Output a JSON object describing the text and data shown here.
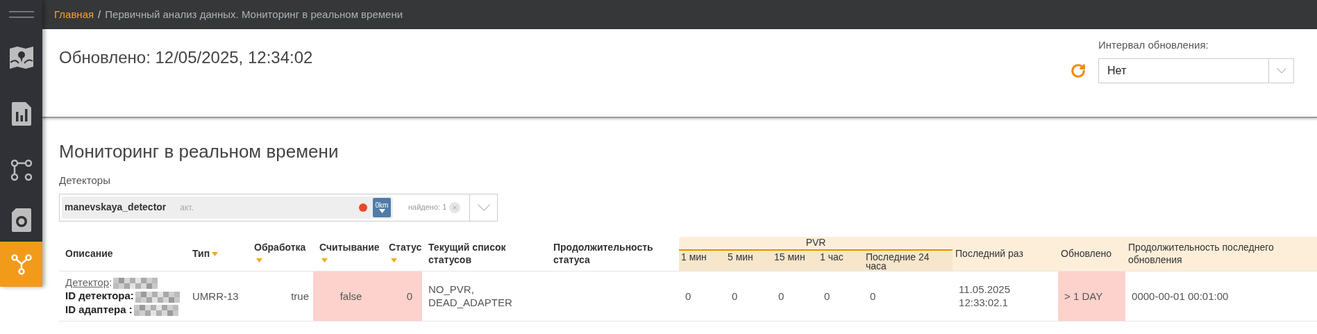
{
  "sidebar": {
    "items": [
      {
        "kind": "menu",
        "selected": false
      },
      {
        "kind": "map",
        "selected": false
      },
      {
        "kind": "report",
        "selected": false
      },
      {
        "kind": "route",
        "selected": false
      },
      {
        "kind": "camera",
        "selected": false
      },
      {
        "kind": "network",
        "selected": true
      }
    ]
  },
  "breadcrumb": {
    "home": "Главная",
    "separator": "/",
    "current": "Первичный анализ данных. Мониторинг в реальном времени"
  },
  "header": {
    "updated": "Обновлено: 12/05/2025, 12:34:02",
    "interval_label": "Интервал обновления:",
    "interval_value": "Нет"
  },
  "section": {
    "title": "Мониторинг в реальном времени",
    "detectors_label": "Детекторы"
  },
  "detector_select": {
    "tag": {
      "name": "manevskaya_detector",
      "state": "акт.",
      "color": "#e8472b",
      "distance": "0km"
    },
    "found": "найдено: 1"
  },
  "table": {
    "columns": [
      {
        "label": "Описание",
        "sortable": false
      },
      {
        "label": "Тип",
        "sortable": true
      },
      {
        "label": "Обработка",
        "sortable": true
      },
      {
        "label": "Считывание",
        "sortable": true
      },
      {
        "label": "Статус",
        "sortable": true
      },
      {
        "label": "Текущий список статусов",
        "sortable": false
      },
      {
        "label": "Продолжительность статуса",
        "sortable": false
      }
    ],
    "pvr": {
      "label": "PVR",
      "columns": [
        "1 мин",
        "5 мин",
        "15 мин",
        "1 час",
        "Последние 24 часа"
      ]
    },
    "tail_columns": [
      "Последний раз",
      "Обновлено",
      "Продолжительность последнего обновления"
    ],
    "rows": [
      {
        "cells": [
          {
            "kind": "description",
            "alert": false,
            "lines": [
              {
                "kind": "link",
                "label": "Детектор",
                "suffix": ":"
              },
              {
                "kind": "field",
                "label": "ID детектора:"
              },
              {
                "kind": "field",
                "label": "ID адаптера :"
              }
            ]
          },
          {
            "text": "UMRR-13",
            "alert": false
          },
          {
            "text": "true",
            "alert": false
          },
          {
            "text": "false",
            "alert": true
          },
          {
            "text": "0",
            "alert": true
          },
          {
            "text": "NO_PVR, DEAD_ADAPTER",
            "alert": false
          },
          {
            "alert": false
          },
          {
            "text": "0",
            "alert": false
          },
          {
            "text": "0",
            "alert": false
          },
          {
            "text": "0",
            "alert": false
          },
          {
            "text": "0",
            "alert": false
          },
          {
            "text": "0",
            "alert": false
          },
          {
            "text": "11.05.2025 12:33:02.1",
            "alert": false
          },
          {
            "text": "> 1 DAY",
            "alert": true
          },
          {
            "text": "0000-00-01 00:01:00",
            "alert": false
          }
        ]
      }
    ]
  }
}
